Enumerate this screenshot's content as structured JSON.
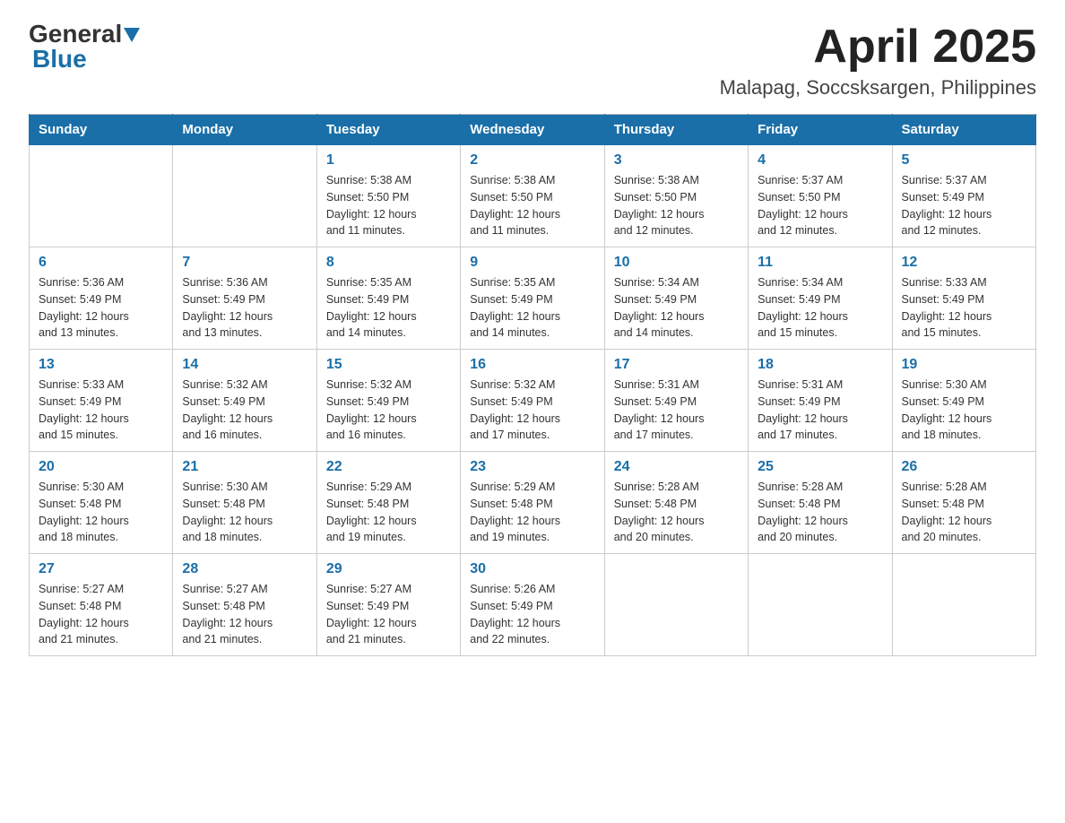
{
  "header": {
    "logo_general": "General",
    "logo_blue": "Blue",
    "month_title": "April 2025",
    "location": "Malapag, Soccsksargen, Philippines"
  },
  "days_of_week": [
    "Sunday",
    "Monday",
    "Tuesday",
    "Wednesday",
    "Thursday",
    "Friday",
    "Saturday"
  ],
  "weeks": [
    [
      {
        "day": "",
        "info": ""
      },
      {
        "day": "",
        "info": ""
      },
      {
        "day": "1",
        "info": "Sunrise: 5:38 AM\nSunset: 5:50 PM\nDaylight: 12 hours\nand 11 minutes."
      },
      {
        "day": "2",
        "info": "Sunrise: 5:38 AM\nSunset: 5:50 PM\nDaylight: 12 hours\nand 11 minutes."
      },
      {
        "day": "3",
        "info": "Sunrise: 5:38 AM\nSunset: 5:50 PM\nDaylight: 12 hours\nand 12 minutes."
      },
      {
        "day": "4",
        "info": "Sunrise: 5:37 AM\nSunset: 5:50 PM\nDaylight: 12 hours\nand 12 minutes."
      },
      {
        "day": "5",
        "info": "Sunrise: 5:37 AM\nSunset: 5:49 PM\nDaylight: 12 hours\nand 12 minutes."
      }
    ],
    [
      {
        "day": "6",
        "info": "Sunrise: 5:36 AM\nSunset: 5:49 PM\nDaylight: 12 hours\nand 13 minutes."
      },
      {
        "day": "7",
        "info": "Sunrise: 5:36 AM\nSunset: 5:49 PM\nDaylight: 12 hours\nand 13 minutes."
      },
      {
        "day": "8",
        "info": "Sunrise: 5:35 AM\nSunset: 5:49 PM\nDaylight: 12 hours\nand 14 minutes."
      },
      {
        "day": "9",
        "info": "Sunrise: 5:35 AM\nSunset: 5:49 PM\nDaylight: 12 hours\nand 14 minutes."
      },
      {
        "day": "10",
        "info": "Sunrise: 5:34 AM\nSunset: 5:49 PM\nDaylight: 12 hours\nand 14 minutes."
      },
      {
        "day": "11",
        "info": "Sunrise: 5:34 AM\nSunset: 5:49 PM\nDaylight: 12 hours\nand 15 minutes."
      },
      {
        "day": "12",
        "info": "Sunrise: 5:33 AM\nSunset: 5:49 PM\nDaylight: 12 hours\nand 15 minutes."
      }
    ],
    [
      {
        "day": "13",
        "info": "Sunrise: 5:33 AM\nSunset: 5:49 PM\nDaylight: 12 hours\nand 15 minutes."
      },
      {
        "day": "14",
        "info": "Sunrise: 5:32 AM\nSunset: 5:49 PM\nDaylight: 12 hours\nand 16 minutes."
      },
      {
        "day": "15",
        "info": "Sunrise: 5:32 AM\nSunset: 5:49 PM\nDaylight: 12 hours\nand 16 minutes."
      },
      {
        "day": "16",
        "info": "Sunrise: 5:32 AM\nSunset: 5:49 PM\nDaylight: 12 hours\nand 17 minutes."
      },
      {
        "day": "17",
        "info": "Sunrise: 5:31 AM\nSunset: 5:49 PM\nDaylight: 12 hours\nand 17 minutes."
      },
      {
        "day": "18",
        "info": "Sunrise: 5:31 AM\nSunset: 5:49 PM\nDaylight: 12 hours\nand 17 minutes."
      },
      {
        "day": "19",
        "info": "Sunrise: 5:30 AM\nSunset: 5:49 PM\nDaylight: 12 hours\nand 18 minutes."
      }
    ],
    [
      {
        "day": "20",
        "info": "Sunrise: 5:30 AM\nSunset: 5:48 PM\nDaylight: 12 hours\nand 18 minutes."
      },
      {
        "day": "21",
        "info": "Sunrise: 5:30 AM\nSunset: 5:48 PM\nDaylight: 12 hours\nand 18 minutes."
      },
      {
        "day": "22",
        "info": "Sunrise: 5:29 AM\nSunset: 5:48 PM\nDaylight: 12 hours\nand 19 minutes."
      },
      {
        "day": "23",
        "info": "Sunrise: 5:29 AM\nSunset: 5:48 PM\nDaylight: 12 hours\nand 19 minutes."
      },
      {
        "day": "24",
        "info": "Sunrise: 5:28 AM\nSunset: 5:48 PM\nDaylight: 12 hours\nand 20 minutes."
      },
      {
        "day": "25",
        "info": "Sunrise: 5:28 AM\nSunset: 5:48 PM\nDaylight: 12 hours\nand 20 minutes."
      },
      {
        "day": "26",
        "info": "Sunrise: 5:28 AM\nSunset: 5:48 PM\nDaylight: 12 hours\nand 20 minutes."
      }
    ],
    [
      {
        "day": "27",
        "info": "Sunrise: 5:27 AM\nSunset: 5:48 PM\nDaylight: 12 hours\nand 21 minutes."
      },
      {
        "day": "28",
        "info": "Sunrise: 5:27 AM\nSunset: 5:48 PM\nDaylight: 12 hours\nand 21 minutes."
      },
      {
        "day": "29",
        "info": "Sunrise: 5:27 AM\nSunset: 5:49 PM\nDaylight: 12 hours\nand 21 minutes."
      },
      {
        "day": "30",
        "info": "Sunrise: 5:26 AM\nSunset: 5:49 PM\nDaylight: 12 hours\nand 22 minutes."
      },
      {
        "day": "",
        "info": ""
      },
      {
        "day": "",
        "info": ""
      },
      {
        "day": "",
        "info": ""
      }
    ]
  ]
}
